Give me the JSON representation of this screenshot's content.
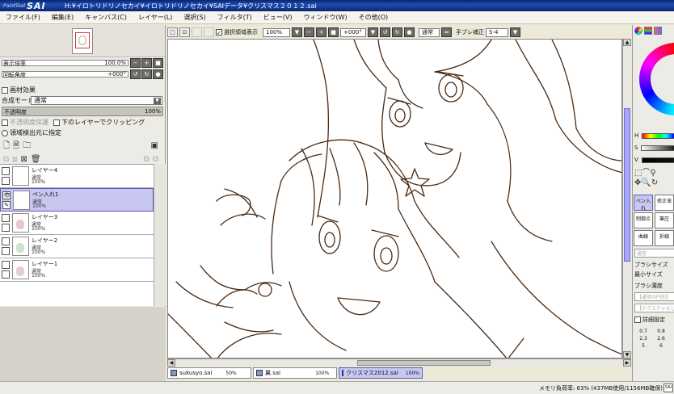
{
  "app": {
    "logo_small": "PaintTool",
    "logo_big": "SAI",
    "title": "H:¥イロトリドリノセカイ¥イロトリドリノセカイ¥SAIデータ¥クリスマス２０１２.sai"
  },
  "menu": [
    "ファイル(F)",
    "編集(E)",
    "キャンバス(C)",
    "レイヤー(L)",
    "選択(S)",
    "フィルタ(T)",
    "ビュー(V)",
    "ウィンドウ(W)",
    "その他(O)"
  ],
  "navigator": {
    "zoom_label": "表示倍率",
    "zoom_value": "100.0%",
    "rotation_label": "回転角度",
    "rotation_value": "+000°"
  },
  "layer_props": {
    "texture_label": "画材効果",
    "blend_label": "合成モード",
    "blend_value": "通常",
    "opacity_label": "不透明度",
    "opacity_value": "100%",
    "protect_label": "不透明度保護",
    "clip_label": "下のレイヤーでクリッピング",
    "detect_label": "領域検出元に指定"
  },
  "layers": [
    {
      "name": "レイヤー4",
      "mode": "通常",
      "opacity": "100%",
      "selected": false
    },
    {
      "name": "ペン入れ1",
      "mode": "通常",
      "opacity": "100%",
      "selected": true
    },
    {
      "name": "レイヤー3",
      "mode": "通常",
      "opacity": "100%",
      "selected": false
    },
    {
      "name": "レイヤー2",
      "mode": "通常",
      "opacity": "100%",
      "selected": false
    },
    {
      "name": "レイヤー1",
      "mode": "通常",
      "opacity": "100%",
      "selected": false
    }
  ],
  "toolbar": {
    "selection_show": "選択領域表示",
    "zoom": "100%",
    "angle": "+000°",
    "blend": "通常",
    "stabilizer_label": "手ブレ補正",
    "stabilizer_value": "S-4"
  },
  "tabs": [
    {
      "name": "sukusyo.sai",
      "pct": "50%"
    },
    {
      "name": "翼.sai",
      "pct": "100%"
    },
    {
      "name": "クリスマス2012.sai",
      "pct": "100%"
    }
  ],
  "status": {
    "memory": "メモリ負荷率: 63% (437MB使用/1156MB確保)",
    "badge": "SAI"
  },
  "right_panel": {
    "h_label": "H",
    "s_label": "S",
    "v_label": "V",
    "tools": [
      {
        "label": "ペン入れ",
        "active": true
      },
      {
        "label": "修正液",
        "active": false
      },
      {
        "label": "制御点",
        "active": false
      },
      {
        "label": "筆圧",
        "active": false
      },
      {
        "label": "曲線",
        "active": false
      },
      {
        "label": "折線",
        "active": false
      }
    ],
    "mode": "通常",
    "brush_size": "ブラシサイズ",
    "min_size": "最小サイズ",
    "brush_density": "ブラシ濃度",
    "shape_placeholder": "【通常の円形】",
    "texture_placeholder": "【テクスチャなし】",
    "detail_label": "詳細設定",
    "sizes": [
      "0.7",
      "0.8",
      "2.3",
      "2.6",
      "5",
      "6"
    ]
  }
}
